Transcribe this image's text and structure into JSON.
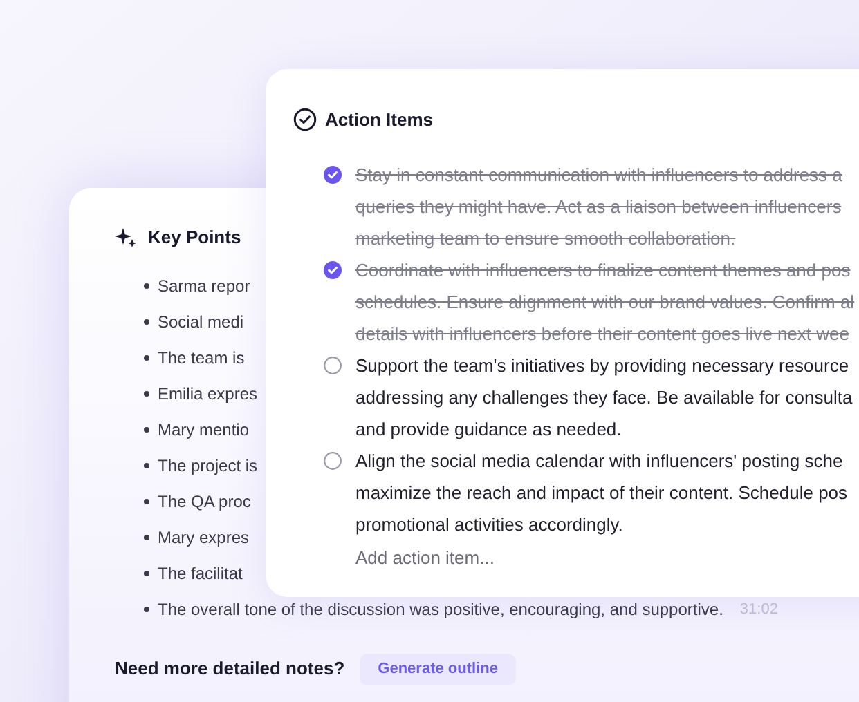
{
  "key_points": {
    "title": "Key Points",
    "items": [
      {
        "text": "Sarma repor"
      },
      {
        "text": "Social medi"
      },
      {
        "text": "The team is"
      },
      {
        "text": "Emilia expres"
      },
      {
        "text": "Mary mentio"
      },
      {
        "text": "The project is"
      },
      {
        "text": "The QA proc"
      },
      {
        "text": "Mary expres"
      },
      {
        "text": "The facilitat"
      },
      {
        "text": "The overall tone of the discussion was positive, encouraging, and supportive.",
        "time": "31:02"
      }
    ],
    "prompt": "Need more detailed notes?",
    "button": "Generate outline"
  },
  "action_items": {
    "title": "Action Items",
    "items": [
      {
        "checked": true,
        "lines": [
          "Stay in constant communication with influencers to address a",
          "queries they might have. Act as a liaison between influencers",
          "marketing team to ensure smooth collaboration."
        ]
      },
      {
        "checked": true,
        "lines": [
          "Coordinate with influencers to finalize content themes and pos",
          "schedules. Ensure alignment with our brand values. Confirm al",
          "details with influencers before their content goes live next wee"
        ]
      },
      {
        "checked": false,
        "lines": [
          "Support the team's initiatives by providing necessary resource",
          "addressing any challenges they face. Be available for consulta",
          "and provide guidance as needed."
        ]
      },
      {
        "checked": false,
        "lines": [
          "Align the social media calendar with influencers' posting sche",
          "maximize the reach and impact of their content. Schedule pos",
          "promotional activities accordingly."
        ]
      }
    ],
    "add_placeholder": "Add action item..."
  }
}
